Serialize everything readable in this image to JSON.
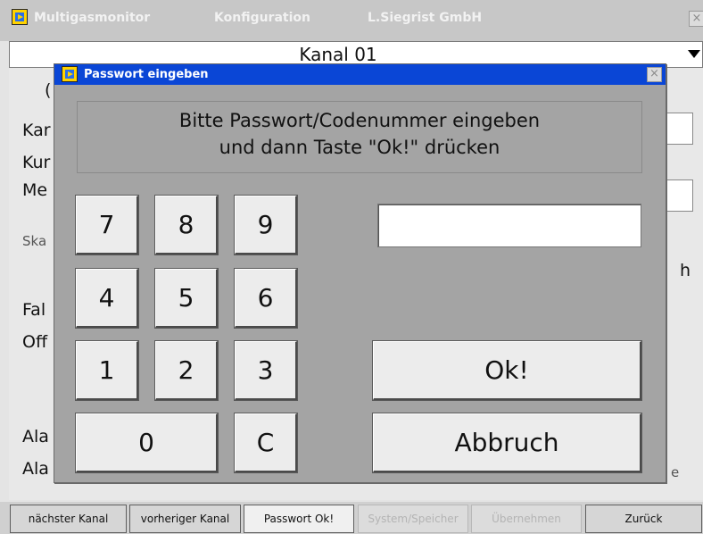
{
  "window": {
    "app_name": "Multigasmonitor",
    "section": "Konfiguration",
    "company": "L.Siegrist GmbH",
    "close_glyph": "×"
  },
  "channel_selector": {
    "value": "Kanal 01"
  },
  "background_form": {
    "fragments": [
      "(",
      "Kar",
      "Kur",
      "Me",
      "Ska",
      "h",
      "Fal",
      "Off",
      "Ala",
      "Ala",
      "e"
    ]
  },
  "dialog": {
    "title": "Passwort eingeben",
    "close_glyph": "×",
    "message_line1": "Bitte Passwort/Codenummer eingeben",
    "message_line2": "und dann Taste \"Ok!\" drücken",
    "password_value": "",
    "keys": [
      "7",
      "8",
      "9",
      "4",
      "5",
      "6",
      "1",
      "2",
      "3",
      "0",
      "C"
    ],
    "ok_label": "Ok!",
    "cancel_label": "Abbruch"
  },
  "toolbar": {
    "next_channel": "nächster Kanal",
    "prev_channel": "vorheriger Kanal",
    "password_ok": "Passwort Ok!",
    "system_save": "System/Speicher",
    "apply": "Übernehmen",
    "back": "Zurück"
  },
  "colors": {
    "dialog_title_bar": "#0a46d6",
    "dialog_body": "#a4a4a4",
    "key_face": "#ececec"
  }
}
